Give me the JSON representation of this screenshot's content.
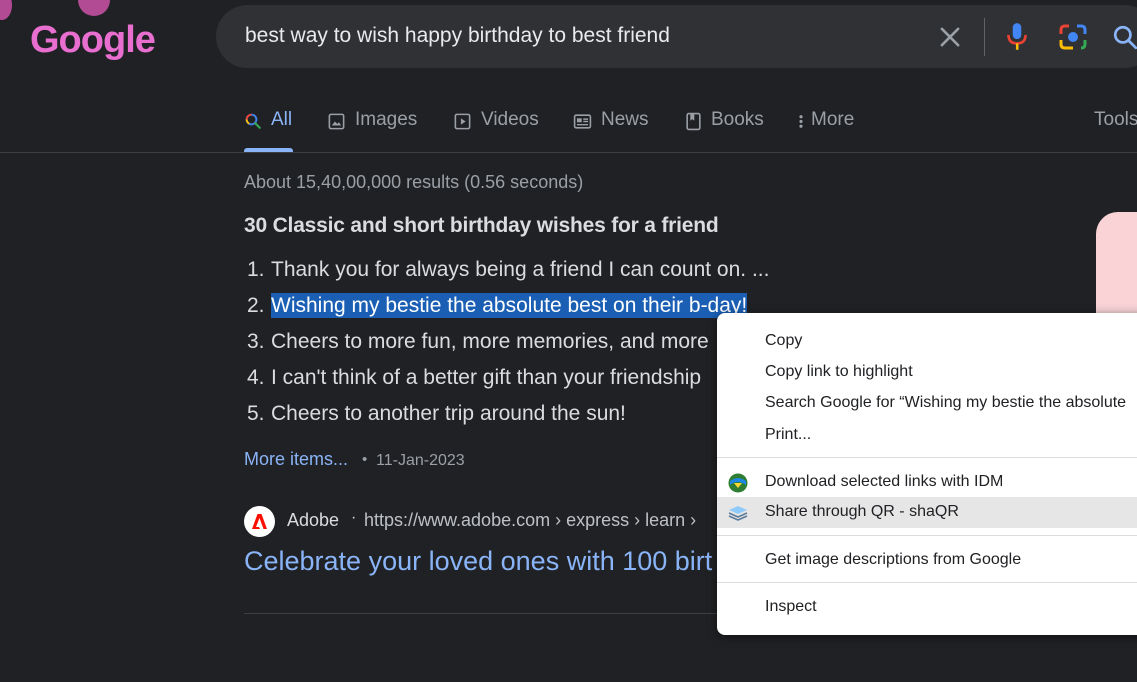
{
  "header": {
    "logo_text": "Google",
    "search_query": "best way to wish happy birthday to best friend",
    "icons": [
      "clear-icon",
      "mic-icon",
      "google-lens-icon",
      "search-icon"
    ]
  },
  "tabs": [
    {
      "label": "All",
      "active": true,
      "icon": "search-icon"
    },
    {
      "label": "Images",
      "icon": "image-icon"
    },
    {
      "label": "Videos",
      "icon": "play-icon"
    },
    {
      "label": "News",
      "icon": "news-icon"
    },
    {
      "label": "Books",
      "icon": "book-icon"
    },
    {
      "label": "More",
      "icon": "more-vert-icon"
    }
  ],
  "tools_label": "Tools",
  "result_stats": "About 15,40,00,000 results (0.56 seconds)",
  "snippet": {
    "title": "30 Classic and short birthday wishes for a friend",
    "items": [
      {
        "num": "1.",
        "text": "Thank you for always being a friend I can count on. ..."
      },
      {
        "num": "2.",
        "text": "Wishing my bestie the absolute best on their b-day!",
        "selected": true
      },
      {
        "num": "3.",
        "text": "Cheers to more fun, more memories, and more"
      },
      {
        "num": "4.",
        "text": "I can't think of a better gift than your friendship"
      },
      {
        "num": "5.",
        "text": "Cheers to another trip around the sun!"
      }
    ],
    "more_items": "More items...",
    "separator": "•",
    "date": "11-Jan-2023"
  },
  "result": {
    "site_name": "Adobe",
    "separator": "·",
    "url": "https://www.adobe.com › express › learn ›",
    "title": "Celebrate your loved ones with 100 birt"
  },
  "context_menu": {
    "items": [
      {
        "label": "Copy"
      },
      {
        "label": "Copy link to highlight"
      },
      {
        "label": "Search Google for “Wishing my bestie the absolute"
      },
      {
        "label": "Print..."
      },
      {
        "label": "Download selected links with IDM",
        "icon": "idm-icon"
      },
      {
        "label": "Share through QR - shaQR",
        "icon": "shaqr-icon",
        "highlighted": true
      },
      {
        "label": "Get image descriptions from Google"
      },
      {
        "label": "Inspect"
      }
    ]
  },
  "colors": {
    "background": "#202124",
    "link": "#8ab4f8",
    "selection": "#1a5fb4",
    "logo": "#e86fd0"
  }
}
